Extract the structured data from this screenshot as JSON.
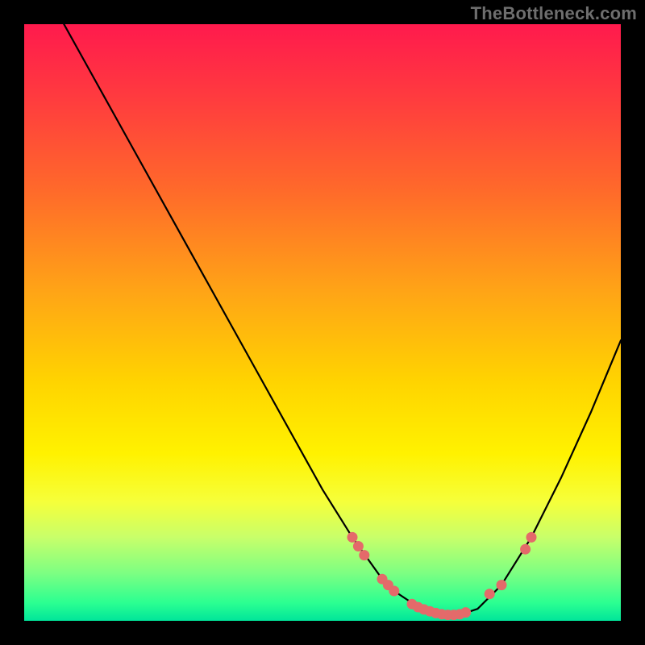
{
  "watermark": "TheBottleneck.com",
  "colors": {
    "bg": "#000000",
    "gradient_top": "#ff1a4d",
    "gradient_bottom": "#00e59a",
    "curve": "#000000",
    "marker": "#e46a6a"
  },
  "chart_data": {
    "type": "line",
    "title": "",
    "xlabel": "",
    "ylabel": "",
    "xlim": [
      0,
      100
    ],
    "ylim": [
      0,
      100
    ],
    "grid": false,
    "series": [
      {
        "name": "curve",
        "x": [
          0,
          5,
          10,
          15,
          20,
          25,
          30,
          35,
          40,
          45,
          50,
          55,
          60,
          62,
          65,
          68,
          70,
          73,
          76,
          80,
          85,
          90,
          95,
          100
        ],
        "y": [
          112,
          103,
          94,
          85,
          76,
          67,
          58,
          49,
          40,
          31,
          22,
          14,
          7,
          5,
          3,
          1.5,
          1,
          1,
          2,
          6,
          14,
          24,
          35,
          47
        ]
      }
    ],
    "markers": [
      {
        "x": 55,
        "y": 14
      },
      {
        "x": 56,
        "y": 12.5
      },
      {
        "x": 57,
        "y": 11
      },
      {
        "x": 60,
        "y": 7
      },
      {
        "x": 61,
        "y": 6
      },
      {
        "x": 62,
        "y": 5
      },
      {
        "x": 65,
        "y": 2.8
      },
      {
        "x": 66,
        "y": 2.3
      },
      {
        "x": 67,
        "y": 1.9
      },
      {
        "x": 68,
        "y": 1.6
      },
      {
        "x": 69,
        "y": 1.3
      },
      {
        "x": 70,
        "y": 1.1
      },
      {
        "x": 71,
        "y": 1.0
      },
      {
        "x": 72,
        "y": 1.0
      },
      {
        "x": 73,
        "y": 1.1
      },
      {
        "x": 74,
        "y": 1.4
      },
      {
        "x": 78,
        "y": 4.5
      },
      {
        "x": 80,
        "y": 6.0
      },
      {
        "x": 84,
        "y": 12
      },
      {
        "x": 85,
        "y": 14
      }
    ]
  }
}
